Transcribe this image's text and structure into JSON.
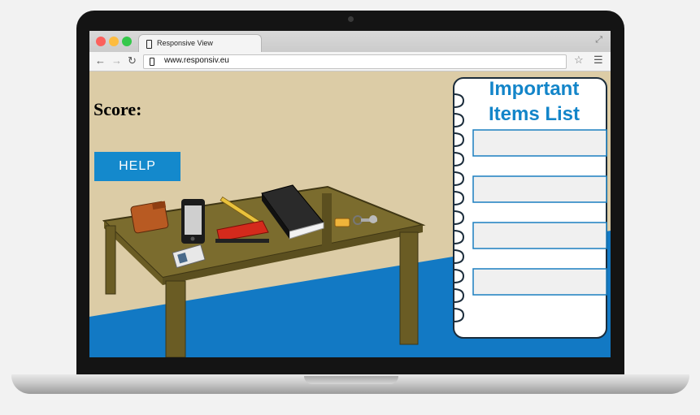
{
  "browser": {
    "tab_title": "Responsive View",
    "url": "www.responsiv.eu",
    "window_controls": [
      "close-dot",
      "minimize-dot",
      "zoom-dot"
    ],
    "colors": {
      "close": "#fc605c",
      "minimize": "#fdbc40",
      "zoom": "#34c84a"
    }
  },
  "game": {
    "score_label": "Score:",
    "help_label": "HELP",
    "list_title_line1": "Important",
    "list_title_line2": "Items List",
    "list_slots": [
      "",
      "",
      "",
      ""
    ],
    "items": [
      "wallet",
      "smartphone",
      "id-card",
      "pencil",
      "stapler",
      "book",
      "keys"
    ],
    "colors": {
      "accent": "#1489cc",
      "floor": "#1279c4",
      "wall": "#dccca6",
      "table": "#7b6c2e"
    }
  }
}
